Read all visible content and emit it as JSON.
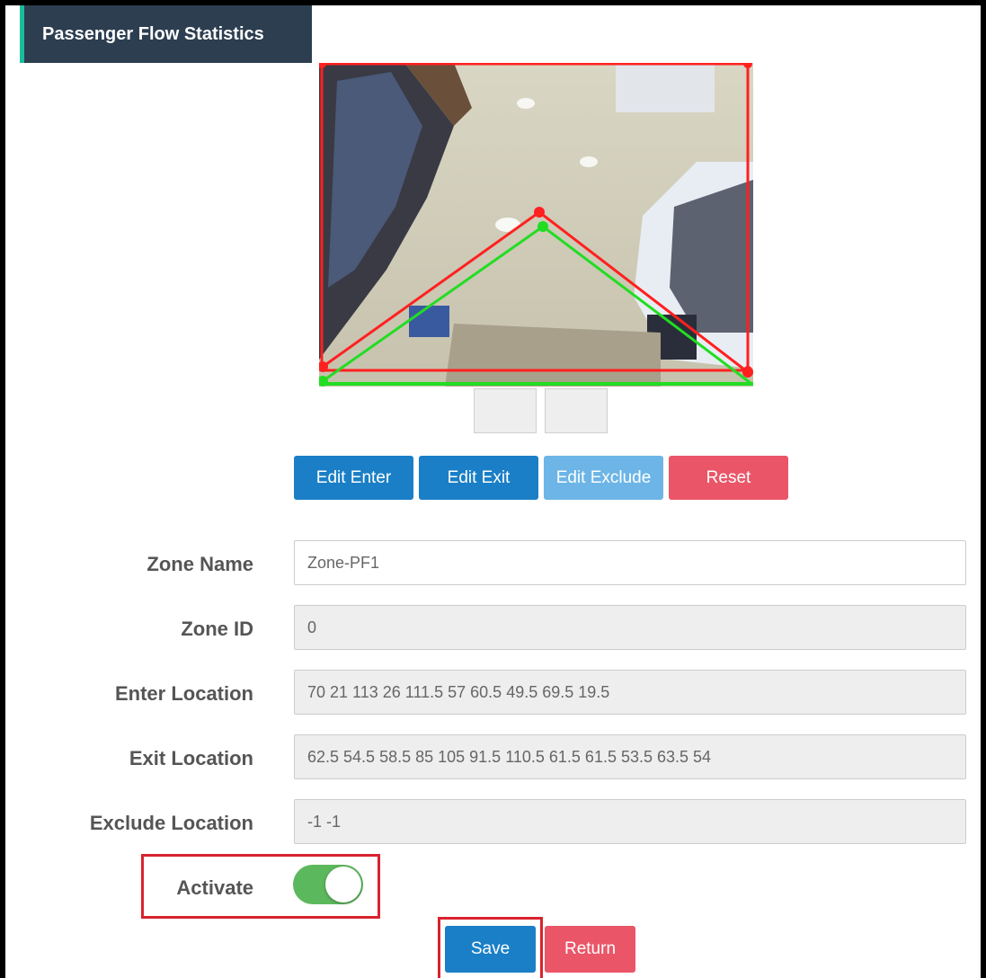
{
  "header": {
    "title": "Passenger Flow Statistics"
  },
  "colors": {
    "enter_line": "#ff2020",
    "exit_line": "#22dd22",
    "accent_blue": "#1a7fc6",
    "danger_red": "#ea5668",
    "toggle_on": "#5cb85c",
    "highlight": "#d9232e"
  },
  "toolbar": {
    "edit_enter": "Edit Enter",
    "edit_exit": "Edit Exit",
    "edit_exclude": "Edit Exclude",
    "reset": "Reset"
  },
  "form": {
    "zone_name": {
      "label": "Zone Name",
      "value": "Zone-PF1"
    },
    "zone_id": {
      "label": "Zone ID",
      "value": "0"
    },
    "enter_location": {
      "label": "Enter Location",
      "value": "70 21 113 26 111.5 57 60.5 49.5 69.5 19.5"
    },
    "exit_location": {
      "label": "Exit Location",
      "value": "62.5 54.5 58.5 85 105 91.5 110.5 61.5 61.5 53.5 63.5 54"
    },
    "exclude_location": {
      "label": "Exclude Location",
      "value": "-1 -1"
    },
    "activate": {
      "label": "Activate",
      "on": true
    }
  },
  "actions": {
    "save": "Save",
    "return": "Return"
  }
}
